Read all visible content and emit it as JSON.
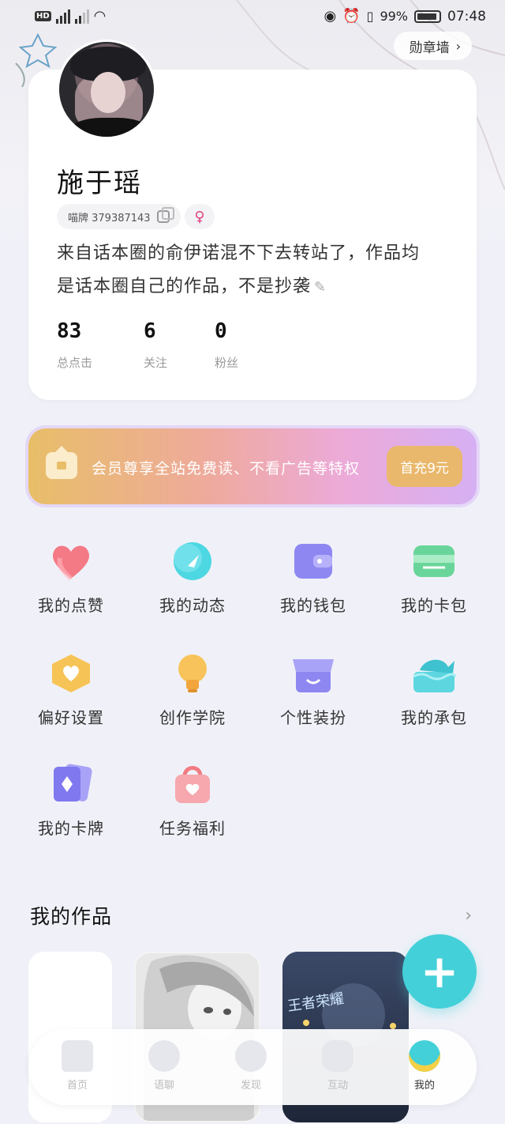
{
  "status_bar": {
    "left_icons": [
      "hd-icon",
      "signal-icon",
      "signal-icon",
      "wifi-icon"
    ],
    "battery": "99%",
    "time": "07:48"
  },
  "header": {
    "badge_wall_label": "勋章墙"
  },
  "profile": {
    "name": "施于瑶",
    "id_label": "喵牌 379387143",
    "gender_symbol": "♀",
    "bio_line1": "来自话本圈的俞伊诺混不下去转站了，作品均",
    "bio_line2": "是话本圈自己的作品，不是抄袭",
    "stats": [
      {
        "value": "83",
        "label": "总点击"
      },
      {
        "value": "6",
        "label": "关注"
      },
      {
        "value": "0",
        "label": "粉丝"
      }
    ]
  },
  "vip": {
    "text": "会员尊享全站免费读、不看广告等特权",
    "button": "首充9元"
  },
  "grid": [
    {
      "label": "我的点赞",
      "icon": "heart-icon"
    },
    {
      "label": "我的动态",
      "icon": "moment-icon"
    },
    {
      "label": "我的钱包",
      "icon": "wallet-icon"
    },
    {
      "label": "我的卡包",
      "icon": "cardholder-icon"
    },
    {
      "label": "偏好设置",
      "icon": "preference-icon"
    },
    {
      "label": "创作学院",
      "icon": "bulb-icon"
    },
    {
      "label": "个性装扮",
      "icon": "shop-icon"
    },
    {
      "label": "我的承包",
      "icon": "whale-icon"
    },
    {
      "label": "我的卡牌",
      "icon": "cards-icon"
    },
    {
      "label": "任务福利",
      "icon": "gift-bag-icon"
    }
  ],
  "works": {
    "title": "我的作品",
    "overlay_text": "王者荣耀"
  },
  "tabbar": [
    {
      "label": "首页",
      "icon": "home-icon"
    },
    {
      "label": "语聊",
      "icon": "voice-chat-icon"
    },
    {
      "label": "发现",
      "icon": "discover-icon"
    },
    {
      "label": "互动",
      "icon": "interact-icon"
    },
    {
      "label": "我的",
      "icon": "me-icon",
      "active": true
    }
  ],
  "colors": {
    "accent": "#44d0d8",
    "vip_button": "#e9b86c"
  }
}
